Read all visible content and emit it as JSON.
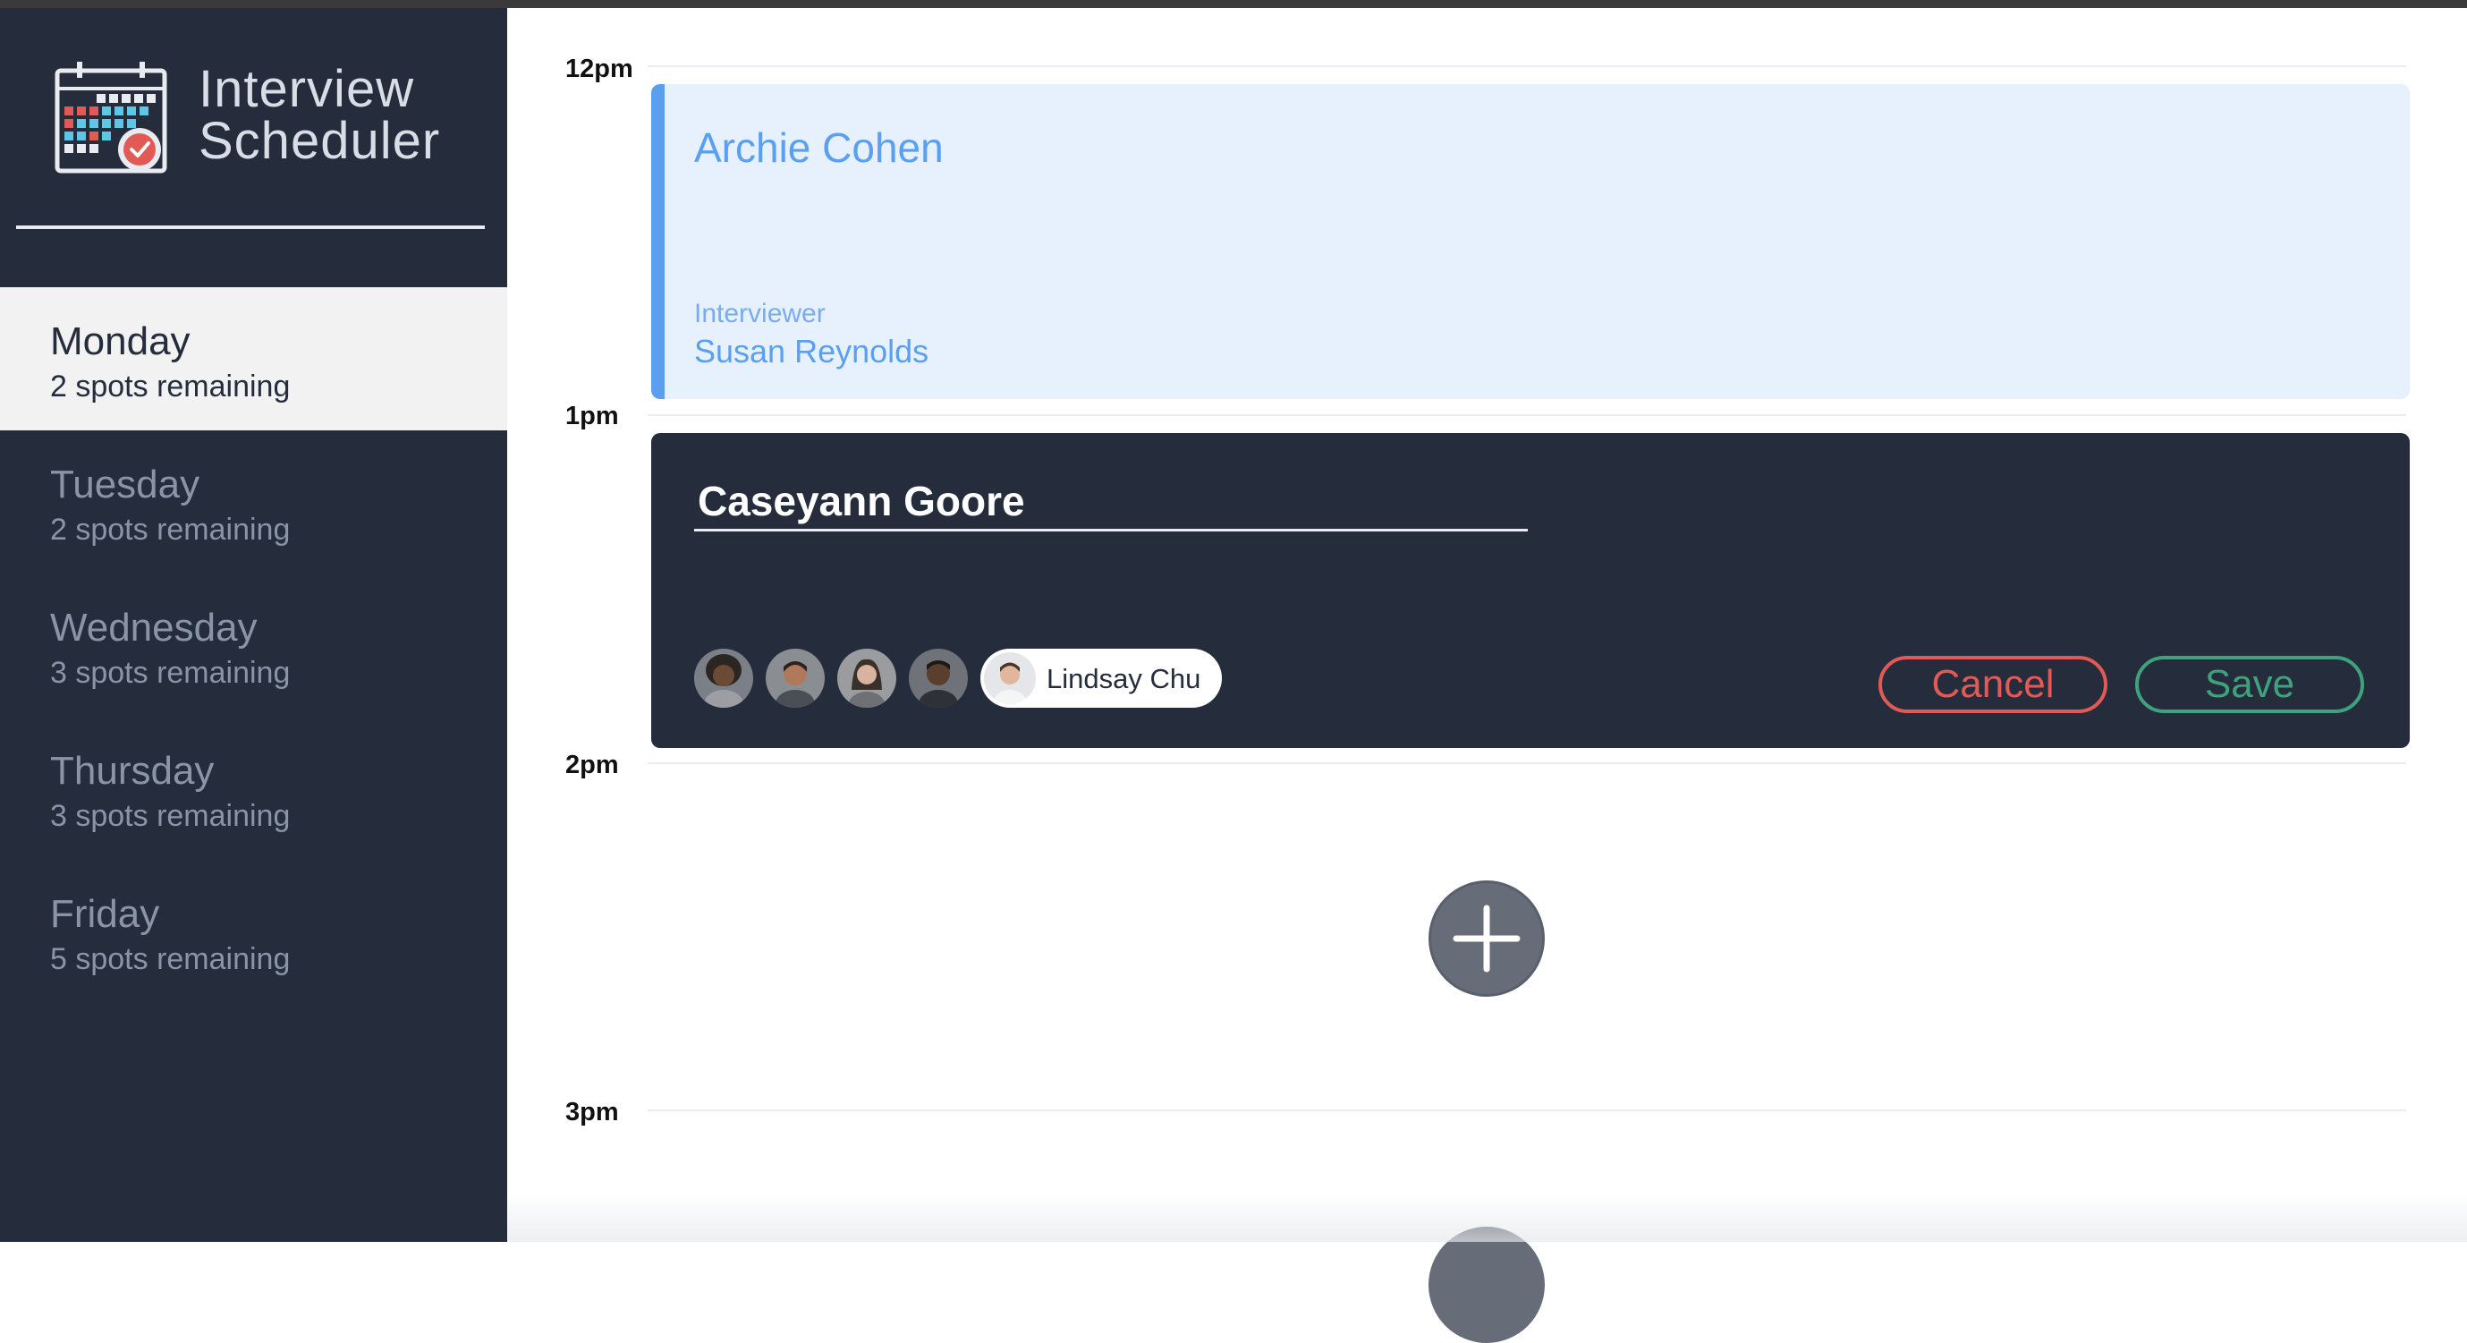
{
  "app": {
    "title_line1": "Interview",
    "title_line2": "Scheduler"
  },
  "sidebar": {
    "days": [
      {
        "name": "Monday",
        "spots": "2 spots remaining",
        "selected": true
      },
      {
        "name": "Tuesday",
        "spots": "2 spots remaining",
        "selected": false
      },
      {
        "name": "Wednesday",
        "spots": "3 spots remaining",
        "selected": false
      },
      {
        "name": "Thursday",
        "spots": "3 spots remaining",
        "selected": false
      },
      {
        "name": "Friday",
        "spots": "5 spots remaining",
        "selected": false
      }
    ]
  },
  "schedule": {
    "hours": [
      "12pm",
      "1pm",
      "2pm",
      "3pm"
    ],
    "appointment_show": {
      "student": "Archie Cohen",
      "interviewer_label": "Interviewer",
      "interviewer": "Susan Reynolds"
    },
    "appointment_form": {
      "student_value": "Caseyann Goore",
      "selected_interviewer": "Lindsay Chu",
      "cancel_label": "Cancel",
      "save_label": "Save"
    }
  },
  "colors": {
    "sidebar_bg": "#252d3c",
    "accent_blue": "#5a9ff0",
    "cancel_red": "#e25a55",
    "save_green": "#3fa27c"
  },
  "icons": {
    "logo": "calendar-check-icon",
    "add": "plus-icon"
  }
}
